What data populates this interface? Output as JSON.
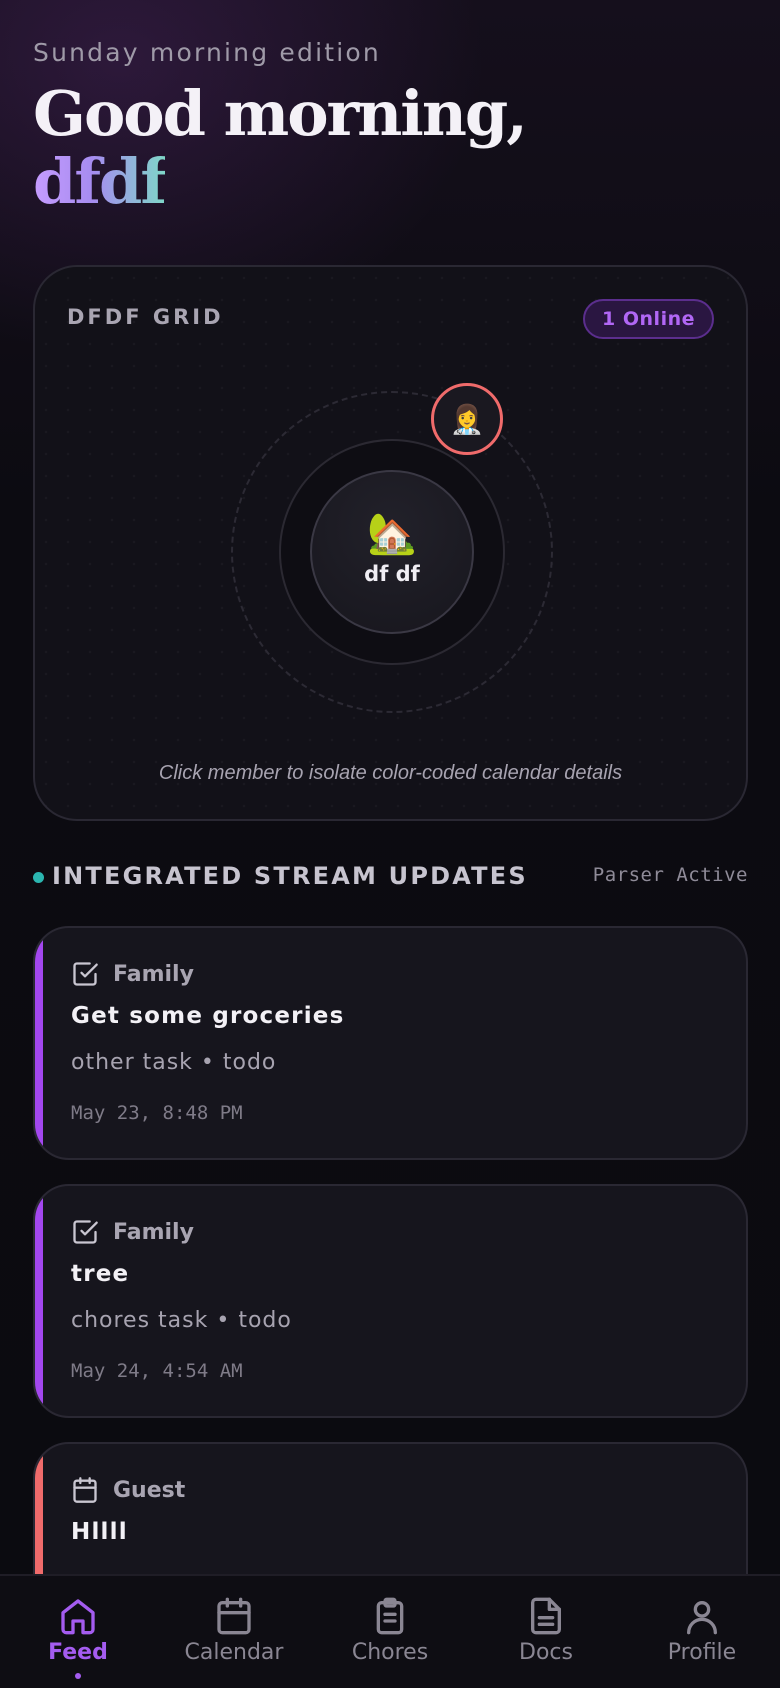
{
  "header": {
    "edition": "Sunday morning edition",
    "greeting": "Good morning,",
    "username": "dfdf"
  },
  "grid": {
    "title": "DFDF GRID",
    "online_badge": "1 Online",
    "hub_icon": "🏡",
    "hub_name": "df df",
    "member_avatar": "👩‍⚕️",
    "member_ring_color": "#f06b6b",
    "hint": "Click member to isolate color-coded calendar details"
  },
  "stream": {
    "title": "INTEGRATED STREAM UPDATES",
    "status": "Parser Active"
  },
  "cards": [
    {
      "icon": "checkbox-icon",
      "category": "Family",
      "title": "Get some groceries",
      "meta": "other task • todo",
      "time": "May 23, 8:48 PM",
      "accent": "#a347ef"
    },
    {
      "icon": "checkbox-icon",
      "category": "Family",
      "title": "tree",
      "meta": "chores task • todo",
      "time": "May 24, 4:54 AM",
      "accent": "#a347ef"
    },
    {
      "icon": "calendar-icon",
      "category": "Guest",
      "title": "Hllll",
      "accent": "#f06b6b"
    }
  ],
  "nav": {
    "items": [
      {
        "label": "Feed",
        "icon": "home-icon"
      },
      {
        "label": "Calendar",
        "icon": "calendar-icon"
      },
      {
        "label": "Chores",
        "icon": "clipboard-icon"
      },
      {
        "label": "Docs",
        "icon": "document-icon"
      },
      {
        "label": "Profile",
        "icon": "user-icon"
      }
    ],
    "active": "Feed",
    "active_color": "#a45cf0"
  }
}
